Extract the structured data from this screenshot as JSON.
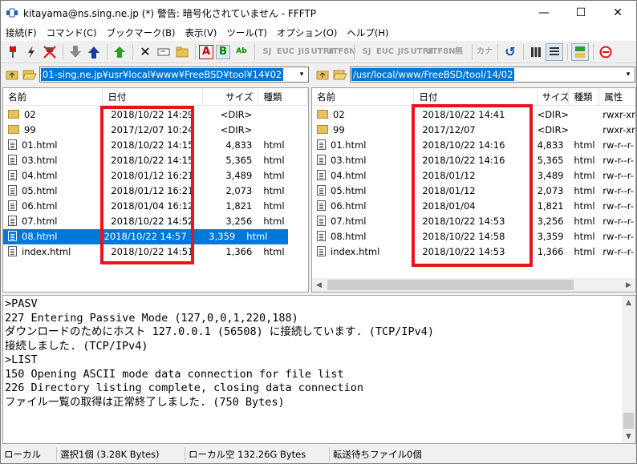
{
  "window": {
    "title": "kitayama@ns.sing.ne.jp (*) 警告: 暗号化されていません - FFFTP",
    "minimize": "—",
    "maximize": "☐",
    "close": "✕"
  },
  "menu": [
    "接続(F)",
    "コマンド(C)",
    "ブックマーク(B)",
    "表示(V)",
    "ツール(T)",
    "オプション(O)",
    "ヘルプ(H)"
  ],
  "toolbar": {
    "connect_icon": "plug-icon",
    "lightning_icon": "lightning-icon",
    "disconnect_icon": "disconnect-icon",
    "download_icon": "download-arrow-icon",
    "upload_icon": "upload-arrow-icon",
    "mirror_icon": "mirror-upload-icon",
    "delete_icon": "delete-icon",
    "rename_icon": "rename-icon",
    "mkdir_icon": "new-folder-icon",
    "ascii_label": "A",
    "binary_label": "B",
    "auto_label": "Ab",
    "kana_labels": [
      "SJ",
      "EUC",
      "JIS",
      "UTF8",
      "UTF8N",
      "SJ",
      "EUC",
      "JIS",
      "UTF8",
      "UTF8N",
      "無"
    ],
    "kana_conv_label": "カナ",
    "refresh_icon": "refresh-icon",
    "list_icon": "list-view-icon",
    "detail_icon": "detail-view-icon",
    "sync_icon": "sync-icon",
    "stop_icon": "stop-icon"
  },
  "local": {
    "path": "01-sing.ne.jp¥usr¥local¥www¥FreeBSD¥tool¥14¥02",
    "headers": [
      "名前",
      "日付",
      "サイズ",
      "種類"
    ],
    "rows": [
      {
        "icon": "folder",
        "name": "02",
        "date": "2018/10/22 14:29",
        "size": "<DIR>",
        "type": ""
      },
      {
        "icon": "folder",
        "name": "99",
        "date": "2017/12/07 10:24",
        "size": "<DIR>",
        "type": ""
      },
      {
        "icon": "file",
        "name": "01.html",
        "date": "2018/10/22 14:15",
        "size": "4,833",
        "type": "html"
      },
      {
        "icon": "file",
        "name": "03.html",
        "date": "2018/10/22 14:15",
        "size": "5,365",
        "type": "html"
      },
      {
        "icon": "file",
        "name": "04.html",
        "date": "2018/01/12 16:21",
        "size": "3,489",
        "type": "html"
      },
      {
        "icon": "file",
        "name": "05.html",
        "date": "2018/01/12 16:21",
        "size": "2,073",
        "type": "html"
      },
      {
        "icon": "file",
        "name": "06.html",
        "date": "2018/01/04 16:12",
        "size": "1,821",
        "type": "html"
      },
      {
        "icon": "file",
        "name": "07.html",
        "date": "2018/10/22 14:52",
        "size": "3,256",
        "type": "html"
      },
      {
        "icon": "file",
        "name": "08.html",
        "date": "2018/10/22 14:57",
        "size": "3,359",
        "type": "html",
        "selected": true
      },
      {
        "icon": "file",
        "name": "index.html",
        "date": "2018/10/22 14:51",
        "size": "1,366",
        "type": "html"
      }
    ]
  },
  "remote": {
    "path": "/usr/local/www/FreeBSD/tool/14/02",
    "headers": [
      "名前",
      "日付",
      "サイズ",
      "種類",
      "属性"
    ],
    "rows": [
      {
        "icon": "folder",
        "name": "02",
        "date": "2018/10/22 14:41",
        "size": "<DIR>",
        "type": "",
        "attr": "rwxr-xr-"
      },
      {
        "icon": "folder",
        "name": "99",
        "date": "2017/12/07",
        "size": "<DIR>",
        "type": "",
        "attr": "rwxr-xr-"
      },
      {
        "icon": "file",
        "name": "01.html",
        "date": "2018/10/22 14:16",
        "size": "4,833",
        "type": "html",
        "attr": "rw-r--r-"
      },
      {
        "icon": "file",
        "name": "03.html",
        "date": "2018/10/22 14:16",
        "size": "5,365",
        "type": "html",
        "attr": "rw-r--r-"
      },
      {
        "icon": "file",
        "name": "04.html",
        "date": "2018/01/12",
        "size": "3,489",
        "type": "html",
        "attr": "rw-r--r-"
      },
      {
        "icon": "file",
        "name": "05.html",
        "date": "2018/01/12",
        "size": "2,073",
        "type": "html",
        "attr": "rw-r--r-"
      },
      {
        "icon": "file",
        "name": "06.html",
        "date": "2018/01/04",
        "size": "1,821",
        "type": "html",
        "attr": "rw-r--r-"
      },
      {
        "icon": "file",
        "name": "07.html",
        "date": "2018/10/22 14:53",
        "size": "3,256",
        "type": "html",
        "attr": "rw-r--r-"
      },
      {
        "icon": "file",
        "name": "08.html",
        "date": "2018/10/22 14:58",
        "size": "3,359",
        "type": "html",
        "attr": "rw-r--r-"
      },
      {
        "icon": "file",
        "name": "index.html",
        "date": "2018/10/22 14:53",
        "size": "1,366",
        "type": "html",
        "attr": "rw-r--r-"
      }
    ]
  },
  "log": [
    ">PASV",
    "227 Entering Passive Mode (127,0,0,1,220,188)",
    "ダウンロードのためにホスト 127.0.0.1 (56508) に接続しています. (TCP/IPv4)",
    "接続しました. (TCP/IPv4)",
    ">LIST",
    "150 Opening ASCII mode data connection for file list",
    "226 Directory listing complete, closing data connection",
    "ファイル一覧の取得は正常終了しました. (750 Bytes)"
  ],
  "status": {
    "local_label": "ローカル",
    "selection": "選択1個 (3.28K Bytes)",
    "free_space": "ローカル空 132.26G Bytes",
    "queue": "転送待ちファイル0個"
  },
  "colors": {
    "highlight": "#e8141c",
    "selection": "#0078d7"
  }
}
